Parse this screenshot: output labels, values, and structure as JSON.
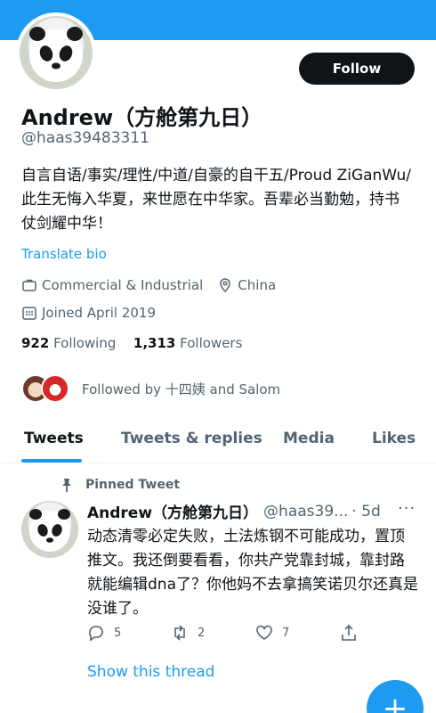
{
  "profile": {
    "display_name": "Andrew（方舱第九日）",
    "handle": "@haas39483311",
    "bio": "自言自语/事实/理性/中道/自豪的自干五/Proud ZiGanWu/此生无悔入华夏，来世愿在中华家。吾辈必当勤勉，持书仗剑耀中华！",
    "translate_label": "Translate bio",
    "category": "Commercial & Industrial",
    "location": "China",
    "joined": "Joined April 2019",
    "following_count": "922",
    "following_label": "Following",
    "followers_count": "1,313",
    "followers_label": "Followers",
    "followed_by": "Followed by 十四姨 and Salom",
    "follow_button": "Follow"
  },
  "tabs": [
    {
      "label": "Tweets",
      "active": true
    },
    {
      "label": "Tweets & replies",
      "active": false
    },
    {
      "label": "Media",
      "active": false
    },
    {
      "label": "Likes",
      "active": false
    }
  ],
  "tweet": {
    "pinned_label": "Pinned Tweet",
    "author_name": "Andrew（方舱第九日）",
    "author_handle": "@haas39...",
    "time": "· 5d",
    "text": "动态清零必定失败，土法炼钢不可能成功，置顶推文。我还倒要看看，你共产党靠封城，靠封路就能编辑dna了？你他妈不去拿搞笑诺贝尔还真是没谁了。",
    "replies": "5",
    "retweets": "2",
    "likes": "7",
    "show_thread": "Show this thread"
  },
  "icons": {
    "category": "briefcase-icon",
    "location": "location-pin-icon",
    "joined": "calendar-icon",
    "pinned": "pin-icon",
    "reply": "reply-icon",
    "retweet": "retweet-icon",
    "like": "heart-icon",
    "share": "share-icon",
    "more": "more-icon",
    "compose": "compose-plus-icon"
  },
  "colors": {
    "accent": "#1d9bf0",
    "text": "#0f1419",
    "muted": "#536471"
  }
}
